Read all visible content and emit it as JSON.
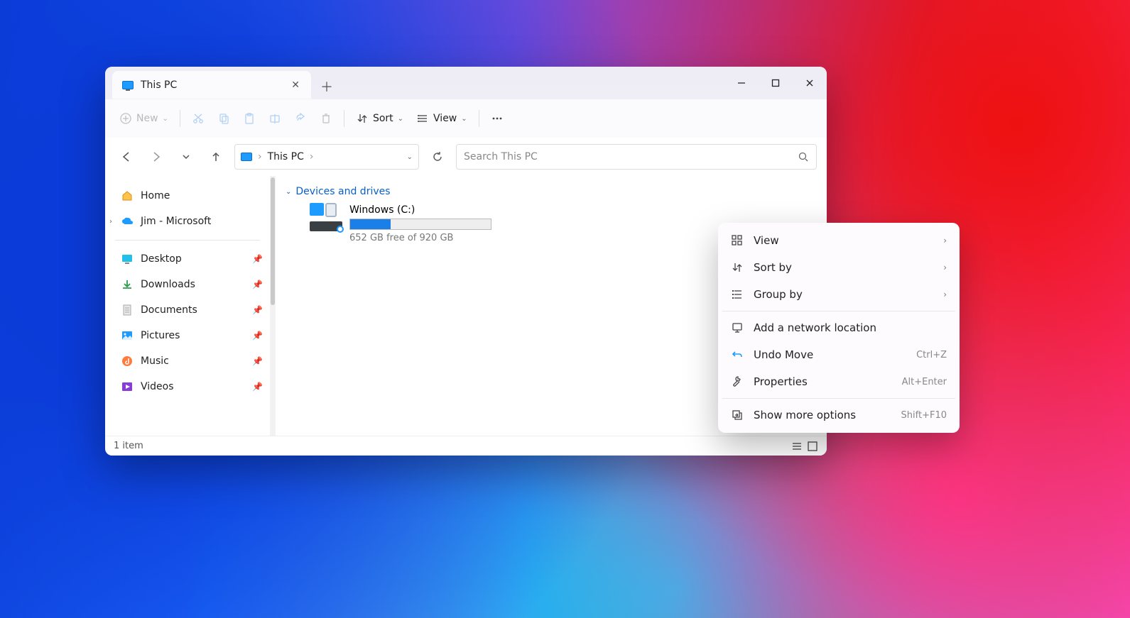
{
  "tab": {
    "title": "This PC"
  },
  "toolbar": {
    "new": "New",
    "sort": "Sort",
    "view": "View"
  },
  "address": {
    "location": "This PC"
  },
  "search": {
    "placeholder": "Search This PC"
  },
  "sidebar": {
    "home": "Home",
    "cloud": "Jim - Microsoft",
    "quick": {
      "desktop": "Desktop",
      "downloads": "Downloads",
      "documents": "Documents",
      "pictures": "Pictures",
      "music": "Music",
      "videos": "Videos"
    }
  },
  "group": {
    "label": "Devices and drives"
  },
  "drive": {
    "name": "Windows  (C:)",
    "free": "652 GB free of 920 GB",
    "fill_percent": 29
  },
  "status": {
    "count": "1 item"
  },
  "context": {
    "view": "View",
    "sort": "Sort by",
    "group": "Group by",
    "network": "Add a network location",
    "undo": "Undo Move",
    "undo_short": "Ctrl+Z",
    "props": "Properties",
    "props_short": "Alt+Enter",
    "more": "Show more options",
    "more_short": "Shift+F10"
  }
}
